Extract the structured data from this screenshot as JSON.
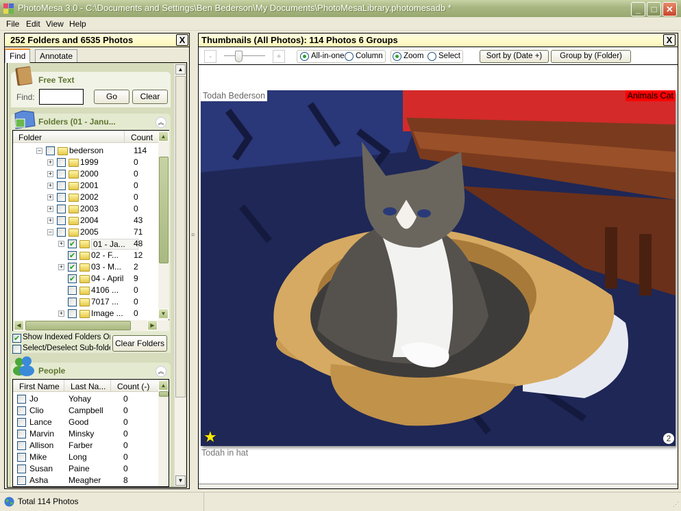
{
  "window": {
    "title": "PhotoMesa 3.0 - C:\\Documents and Settings\\Ben Bederson\\My Documents\\PhotoMesaLibrary.photomesadb *",
    "buttons": [
      "minimize",
      "maximize",
      "close"
    ]
  },
  "menu": [
    {
      "label": "File"
    },
    {
      "label": "Edit"
    },
    {
      "label": "View"
    },
    {
      "label": "Help"
    }
  ],
  "left": {
    "header": "252 Folders and 6535 Photos",
    "close": "X",
    "tabs": [
      {
        "label": "Find",
        "active": true
      },
      {
        "label": "Annotate",
        "active": false
      }
    ],
    "free_text": {
      "title": "Free Text",
      "find_label": "Find:",
      "find_value": "",
      "go": "Go",
      "clear": "Clear"
    },
    "folders": {
      "title": "Folders (01 - Janu...",
      "col_folder": "Folder",
      "col_count": "Count",
      "rows": [
        {
          "level": 0,
          "exp": "-",
          "checked": false,
          "label": "bederson",
          "count": "114"
        },
        {
          "level": 1,
          "exp": "+",
          "checked": false,
          "label": "1999",
          "count": "0"
        },
        {
          "level": 1,
          "exp": "+",
          "checked": false,
          "label": "2000",
          "count": "0"
        },
        {
          "level": 1,
          "exp": "+",
          "checked": false,
          "label": "2001",
          "count": "0"
        },
        {
          "level": 1,
          "exp": "+",
          "checked": false,
          "label": "2002",
          "count": "0"
        },
        {
          "level": 1,
          "exp": "+",
          "checked": false,
          "label": "2003",
          "count": "0"
        },
        {
          "level": 1,
          "exp": "+",
          "checked": false,
          "label": "2004",
          "count": "43"
        },
        {
          "level": 1,
          "exp": "-",
          "checked": false,
          "label": "2005",
          "count": "71"
        },
        {
          "level": 2,
          "exp": "+",
          "checked": true,
          "label": "01 - Ja...",
          "count": "48",
          "selected": true
        },
        {
          "level": 2,
          "exp": "",
          "checked": true,
          "label": "02 - F...",
          "count": "12"
        },
        {
          "level": 2,
          "exp": "+",
          "checked": true,
          "label": "03 - M...",
          "count": "2"
        },
        {
          "level": 2,
          "exp": "",
          "checked": true,
          "label": "04 - April",
          "count": "9"
        },
        {
          "level": 2,
          "exp": "",
          "checked": false,
          "label": "4106 ...",
          "count": "0"
        },
        {
          "level": 2,
          "exp": "",
          "checked": false,
          "label": "7017 ...",
          "count": "0"
        },
        {
          "level": 2,
          "exp": "+",
          "checked": false,
          "label": "Image ...",
          "count": "0"
        }
      ],
      "show_indexed": {
        "label": "Show Indexed Folders Only",
        "checked": true
      },
      "select_sub": {
        "label": "Select/Deselect Sub-folders",
        "checked": false
      },
      "clear_folders": "Clear Folders"
    },
    "people": {
      "title": "People",
      "cols": [
        "First Name",
        "Last Na...",
        "Count (-)"
      ],
      "rows": [
        {
          "first": "Jo",
          "last": "Yohay",
          "count": "0"
        },
        {
          "first": "Clio",
          "last": "Campbell",
          "count": "0"
        },
        {
          "first": "Lance",
          "last": "Good",
          "count": "0"
        },
        {
          "first": "Marvin",
          "last": "Minsky",
          "count": "0"
        },
        {
          "first": "Allison",
          "last": "Farber",
          "count": "0"
        },
        {
          "first": "Mike",
          "last": "Long",
          "count": "0"
        },
        {
          "first": "Susan",
          "last": "Paine",
          "count": "0"
        },
        {
          "first": "Asha",
          "last": "Meagher",
          "count": "8"
        }
      ]
    }
  },
  "right": {
    "header": "Thumbnails (All Photos): 114 Photos 6 Groups",
    "close": "X",
    "toolbar": {
      "minus": "-",
      "plus": "+",
      "zoom_level": 0.35,
      "all_in_one": "All-in-one",
      "column": "Column",
      "zoom": "Zoom",
      "select": "Select",
      "layout_selected": "All-in-one",
      "mode_selected": "Zoom",
      "sort": "Sort by (Date +)",
      "group": "Group by (Folder)"
    },
    "photo": {
      "person_tag": "Todah Bederson",
      "category_tag": "Animals Cat",
      "caption": "Todah in hat",
      "badge": "2",
      "starred": true,
      "tag_color": "#ff0000"
    }
  },
  "status": {
    "text": "Total 114 Photos"
  }
}
